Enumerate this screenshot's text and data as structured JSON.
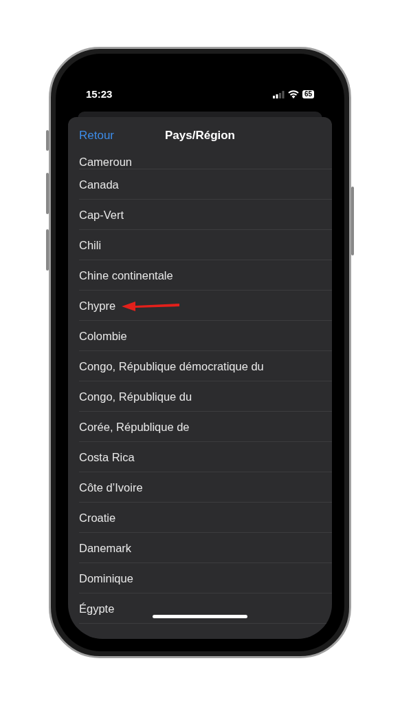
{
  "status_bar": {
    "time": "15:23",
    "battery": "65"
  },
  "nav": {
    "back": "Retour",
    "title": "Pays/Région"
  },
  "countries": [
    {
      "name": "Cameroun",
      "annotated": false
    },
    {
      "name": "Canada",
      "annotated": false
    },
    {
      "name": "Cap-Vert",
      "annotated": false
    },
    {
      "name": "Chili",
      "annotated": false
    },
    {
      "name": "Chine continentale",
      "annotated": false
    },
    {
      "name": "Chypre",
      "annotated": true
    },
    {
      "name": "Colombie",
      "annotated": false
    },
    {
      "name": "Congo, République démocratique du",
      "annotated": false
    },
    {
      "name": "Congo, République du",
      "annotated": false
    },
    {
      "name": "Corée, République de",
      "annotated": false
    },
    {
      "name": "Costa Rica",
      "annotated": false
    },
    {
      "name": "Côte d’Ivoire",
      "annotated": false
    },
    {
      "name": "Croatie",
      "annotated": false
    },
    {
      "name": "Danemark",
      "annotated": false
    },
    {
      "name": "Dominique",
      "annotated": false
    },
    {
      "name": "Égypte",
      "annotated": false
    }
  ]
}
